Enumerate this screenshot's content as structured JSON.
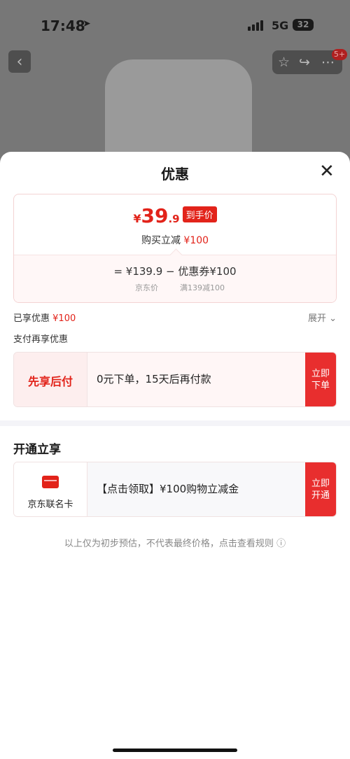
{
  "status": {
    "time": "17:48",
    "network": "5G",
    "battery": "32"
  },
  "overlay_badge": "5+",
  "sheet": {
    "title": "优惠",
    "price": {
      "yen": "¥",
      "int": "39",
      "dec": ".9",
      "tag": "到手价"
    },
    "reduce": {
      "label": "购买立减",
      "amount": "¥100"
    },
    "formula": "= ¥139.9 − 优惠券¥100",
    "formula_sub1": "京东价",
    "formula_sub2": "满139减100",
    "enjoyed_label": "已享优惠",
    "enjoyed_amount": "¥100",
    "expand_label": "展开",
    "pay_more_label": "支付再享优惠",
    "bnpl": {
      "label": "先享后付",
      "text": "0元下单，15天后再付款",
      "button": "立即下单"
    },
    "open_title": "开通立享",
    "jd_card": {
      "label": "京东联名卡",
      "text": "【点击领取】¥100购物立减金",
      "button": "立即开通"
    },
    "disclaimer": "以上仅为初步预估，不代表最终价格，点击查看规则"
  }
}
